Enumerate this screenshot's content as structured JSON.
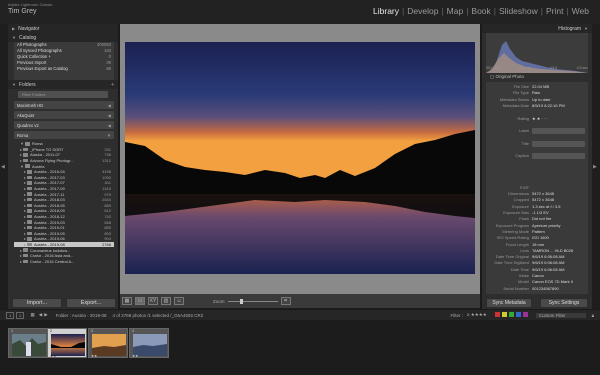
{
  "app": {
    "title": "Adobe Lightroom Classic",
    "user": "Tim Grey"
  },
  "modules": [
    {
      "label": "Library",
      "active": true
    },
    {
      "label": "Develop",
      "active": false
    },
    {
      "label": "Map",
      "active": false
    },
    {
      "label": "Book",
      "active": false
    },
    {
      "label": "Slideshow",
      "active": false
    },
    {
      "label": "Print",
      "active": false
    },
    {
      "label": "Web",
      "active": false
    }
  ],
  "left": {
    "navigator_label": "Navigator",
    "catalog_label": "Catalog",
    "catalog_items": [
      {
        "label": "All Photographs",
        "count": "400083"
      },
      {
        "label": "All Synced Photographs",
        "count": "193"
      },
      {
        "label": "Quick Collection +",
        "count": "0"
      },
      {
        "label": "Previous Import",
        "count": "39"
      },
      {
        "label": "Previous Export as Catalog",
        "count": "86"
      }
    ],
    "folders_label": "Folders",
    "filter_placeholder": "Filter Folders",
    "volumes": [
      {
        "label": "Macintosh HD",
        "info": ""
      },
      {
        "label": "AkaQuiet",
        "info": ""
      },
      {
        "label": "Quadrex v2",
        "info": ""
      },
      {
        "label": "Roma",
        "info": ""
      }
    ],
    "folders": [
      {
        "name": "Roma",
        "count": ""
      },
      {
        "name": "_iPhone TO SORT",
        "count": "231"
      },
      {
        "name": "Alaska - 2011-07",
        "count": "736"
      },
      {
        "name": "Arizona Flying Photogr...",
        "count": "1312"
      },
      {
        "name": "Austria",
        "count": ""
      },
      {
        "name": "Austria - 2016-04",
        "count": "4198"
      },
      {
        "name": "Austria - 2017-03",
        "count": "1093"
      },
      {
        "name": "Austria - 2017-07",
        "count": "811"
      },
      {
        "name": "Austria - 2017-09",
        "count": "1419"
      },
      {
        "name": "Austria - 2017-11",
        "count": "970"
      },
      {
        "name": "Austria - 2018-03",
        "count": "2544"
      },
      {
        "name": "Austria - 2018-05",
        "count": "889"
      },
      {
        "name": "Austria - 2018-09",
        "count": "612"
      },
      {
        "name": "Austria - 2018-12",
        "count": "742"
      },
      {
        "name": "Austria - 2019-03",
        "count": "568"
      },
      {
        "name": "Austria - 2019-01",
        "count": "859"
      },
      {
        "name": "Austria - 2019-05",
        "count": "893"
      },
      {
        "name": "Austria - 2019-06",
        "count": "904"
      },
      {
        "name": "Austria - 2019-08",
        "count": "2768",
        "selected": true
      },
      {
        "name": "Coronavirus lockdow...",
        "count": ""
      },
      {
        "name": "Crafur - 2016 Asia and...",
        "count": ""
      },
      {
        "name": "Crafur - 2016 Central A...",
        "count": ""
      }
    ],
    "import_label": "Import...",
    "export_label": "Export..."
  },
  "toolbar": {
    "zoom_label": "Zoom",
    "zoom_level": 0.24
  },
  "right": {
    "histogram_label": "Histogram",
    "histo_stats": [
      "ISO 1600",
      "18 mm",
      "f/4.0",
      "1/3 sec"
    ],
    "original_photo_label": "Original Photo",
    "metadata": [
      {
        "key": "File Size",
        "value": "22.04 MB"
      },
      {
        "key": "File Type",
        "value": "Raw"
      },
      {
        "key": "Metadata Status",
        "value": "Up to date"
      },
      {
        "key": "Metadata Date",
        "value": "8/5/19 8:22:16 PM"
      },
      {
        "key": "",
        "value": ""
      },
      {
        "key": "Rating",
        "value": "★ ★ · · ·"
      },
      {
        "key": "",
        "value": ""
      },
      {
        "key": "Label",
        "value": ""
      },
      {
        "key": "",
        "value": ""
      },
      {
        "key": "Title",
        "value": ""
      },
      {
        "key": "",
        "value": ""
      },
      {
        "key": "Caption",
        "value": ""
      },
      {
        "key": "",
        "value": ""
      },
      {
        "key": "",
        "value": ""
      },
      {
        "key": "",
        "value": ""
      },
      {
        "key": "",
        "value": ""
      },
      {
        "key": "EXIF",
        "value": ""
      },
      {
        "key": "Dimensions",
        "value": "5472 x 3648"
      },
      {
        "key": "Cropped",
        "value": "5472 x 3648"
      },
      {
        "key": "Exposure",
        "value": "1.3 sec at f / 3.5"
      },
      {
        "key": "Exposure Bias",
        "value": "-1 1/3 EV"
      },
      {
        "key": "Flash",
        "value": "Did not fire"
      },
      {
        "key": "Exposure Program",
        "value": "Aperture priority"
      },
      {
        "key": "Metering Mode",
        "value": "Pattern"
      },
      {
        "key": "ISO Speed Rating",
        "value": "ISO 1600"
      },
      {
        "key": "Focal Length",
        "value": "18 mm"
      },
      {
        "key": "Lens",
        "value": "TAMRON ... HLD B028"
      },
      {
        "key": "Date Time Original",
        "value": "9/6/19 6:06:08 AM"
      },
      {
        "key": "Date Time Digitized",
        "value": "9/6/19 6:06:08 AM"
      },
      {
        "key": "Date Time",
        "value": "9/6/19 6:06:08 AM"
      },
      {
        "key": "Make",
        "value": "Canon"
      },
      {
        "key": "Model",
        "value": "Canon EOS 7D Mark II"
      },
      {
        "key": "Serial Number",
        "value": "001234567890"
      }
    ],
    "sync_metadata_label": "Sync Metadata",
    "sync_settings_label": "Sync Settings"
  },
  "filmstrip": {
    "page1": "1",
    "page2": "2",
    "path": "Folder : Austria - 2019-08",
    "count_text": "4 of 2768 photos /1 selected /_G6A4592.CR2",
    "filter_label": "Filter :",
    "filter_preset": "Custom Filter",
    "thumbs": [
      {
        "num": "1",
        "stars": ""
      },
      {
        "num": "2",
        "stars": "★★"
      },
      {
        "num": "3",
        "stars": "★★"
      },
      {
        "num": "4",
        "stars": "★★"
      }
    ],
    "label_colors": [
      "#c33",
      "#cc3",
      "#3a3",
      "#36c",
      "#939"
    ]
  }
}
